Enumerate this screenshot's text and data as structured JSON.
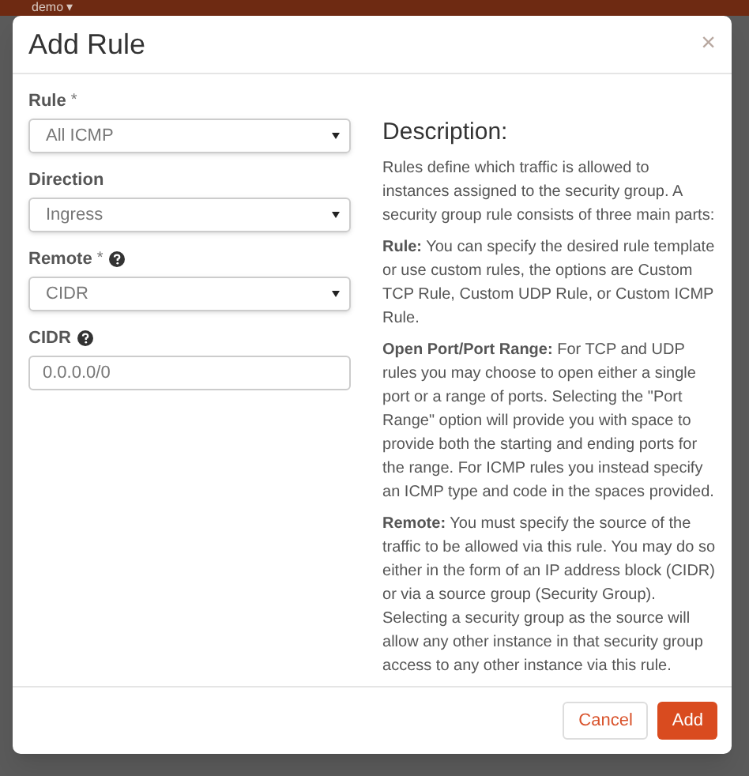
{
  "top_bar": {
    "project": "demo ▾"
  },
  "modal": {
    "title": "Add Rule",
    "close": "×",
    "fields": [
      {
        "kind": "select",
        "label": "Rule",
        "required_mark": "*",
        "help": false,
        "value": "All ICMP"
      },
      {
        "kind": "select",
        "label": "Direction",
        "help": false,
        "value": "Ingress"
      },
      {
        "kind": "select",
        "label": "Remote",
        "required_mark": "*",
        "help": true,
        "value": "CIDR"
      },
      {
        "kind": "text",
        "label": "CIDR",
        "help": true,
        "value": "0.0.0.0/0"
      }
    ],
    "description": {
      "heading": "Description:",
      "paragraphs": [
        "Rules define which traffic is allowed to instances assigned to the security group. A security group rule consists of three main parts:",
        "**Rule:** You can specify the desired rule template or use custom rules, the options are Custom TCP Rule, Custom UDP Rule, or Custom ICMP Rule.",
        "**Open Port/Port Range:** For TCP and UDP rules you may choose to open either a single port or a range of ports. Selecting the \"Port Range\" option will provide you with space to provide both the starting and ending ports for the range. For ICMP rules you instead specify an ICMP type and code in the spaces provided.",
        "**Remote:** You must specify the source of the traffic to be allowed via this rule. You may do so either in the form of an IP address block (CIDR) or via a source group (Security Group). Selecting a security group as the source will allow any other instance in that security group access to any other instance via this rule."
      ]
    },
    "buttons": [
      {
        "kind": "secondary",
        "label": "Cancel"
      },
      {
        "kind": "primary",
        "label": "Add"
      }
    ]
  }
}
